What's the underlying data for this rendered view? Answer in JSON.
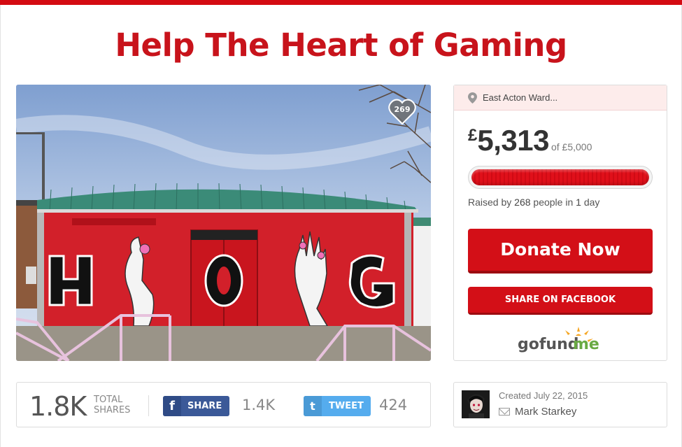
{
  "title": "Help The Heart of Gaming",
  "photo": {
    "heart_count": "269",
    "mural_letters": [
      "H",
      "O",
      "G"
    ]
  },
  "location": "East Acton Ward...",
  "donation": {
    "currency": "£",
    "raised": "5,313",
    "goal_text": "of £5,000",
    "progress_fraction": 1.0,
    "raised_by_prefix": "Raised by",
    "donor_count": "268",
    "raised_by_middle": "people in",
    "duration": "1",
    "raised_by_suffix": "day"
  },
  "buttons": {
    "donate": "Donate Now",
    "share_facebook": "SHARE ON FACEBOOK"
  },
  "brand": {
    "logo_text_a": "gofund",
    "logo_text_b": "me",
    "accent_color": "#d30f17",
    "logo_green": "#6aaa43",
    "logo_orange": "#f5a623"
  },
  "shares": {
    "total": "1.8K",
    "total_label_1": "TOTAL",
    "total_label_2": "SHARES",
    "facebook_label": "SHARE",
    "facebook_count": "1.4K",
    "twitter_label": "TWEET",
    "twitter_count": "424",
    "facebook_color": "#3b5998",
    "twitter_color": "#55acee"
  },
  "organizer": {
    "created": "Created July 22, 2015",
    "name": "Mark Starkey"
  },
  "icons": {
    "location": "map-pin-icon",
    "heart": "heart-icon",
    "mail": "mail-icon",
    "facebook": "facebook-icon",
    "twitter": "twitter-icon"
  }
}
